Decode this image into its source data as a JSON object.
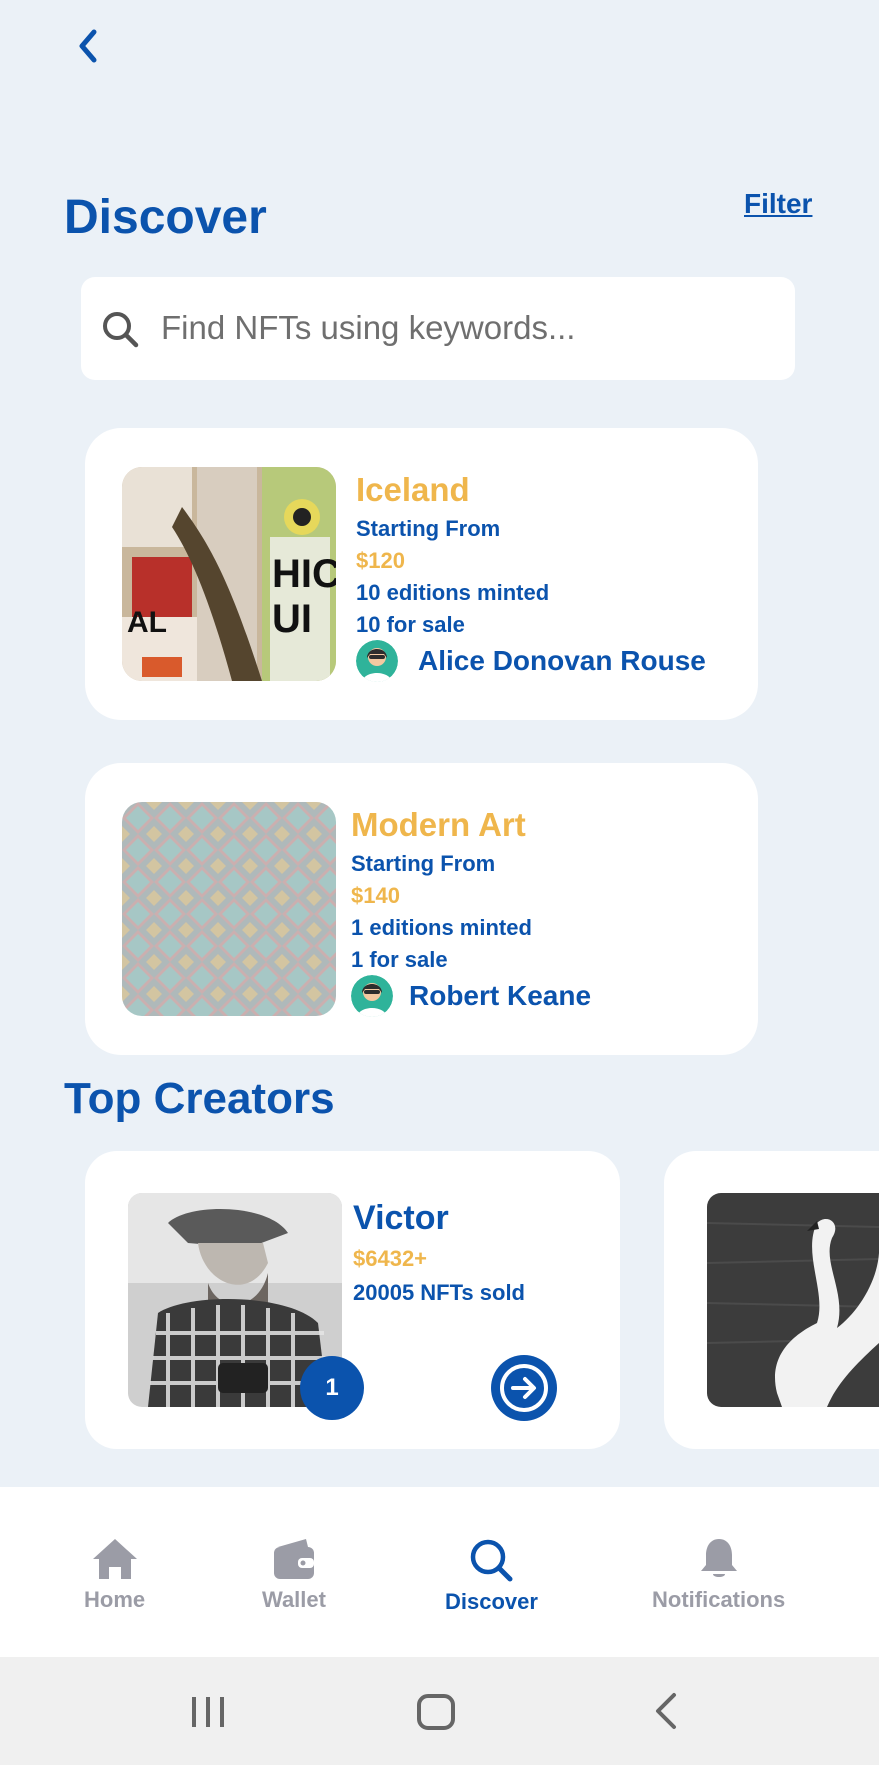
{
  "header": {
    "title": "Discover",
    "filter_label": "Filter"
  },
  "search": {
    "placeholder": "Find NFTs using keywords..."
  },
  "nfts": [
    {
      "name": "Iceland",
      "starting_label": "Starting From",
      "price": "$120",
      "editions": "10 editions minted",
      "for_sale": "10 for sale",
      "creator": "Alice Donovan Rouse"
    },
    {
      "name": "Modern Art",
      "starting_label": "Starting From",
      "price": "$140",
      "editions": "1 editions minted",
      "for_sale": "1 for sale",
      "creator": "Robert Keane"
    }
  ],
  "top_creators": {
    "title": "Top Creators",
    "items": [
      {
        "name": "Victor",
        "sales": "$6432+",
        "sold": "20005 NFTs sold",
        "rank": "1"
      }
    ]
  },
  "bottom_nav": {
    "items": [
      {
        "label": "Home",
        "icon": "home-icon"
      },
      {
        "label": "Wallet",
        "icon": "wallet-icon"
      },
      {
        "label": "Discover",
        "icon": "search-icon",
        "active": true
      },
      {
        "label": "Notifications",
        "icon": "bell-icon"
      }
    ]
  },
  "colors": {
    "primary": "#0b53ad",
    "accent": "#efb64c",
    "background": "#ebf1f7",
    "inactive": "#9b9ca6"
  }
}
